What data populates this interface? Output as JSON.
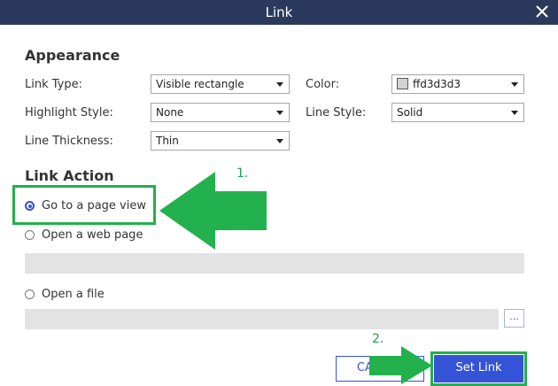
{
  "dialog": {
    "title": "Link",
    "close_icon": "close-icon"
  },
  "appearance": {
    "heading": "Appearance",
    "link_type": {
      "label": "Link Type:",
      "value": "Visible rectangle"
    },
    "color": {
      "label": "Color:",
      "value": "ffd3d3d3",
      "swatch": "#d3d3d3"
    },
    "highlight_style": {
      "label": "Highlight Style:",
      "value": "None"
    },
    "line_style": {
      "label": "Line Style:",
      "value": "Solid"
    },
    "line_thickness": {
      "label": "Line Thickness:",
      "value": "Thin"
    }
  },
  "link_action": {
    "heading": "Link Action",
    "options": [
      {
        "label": "Go to a page view",
        "selected": true
      },
      {
        "label": "Open a web page",
        "selected": false
      },
      {
        "label": "Open a file",
        "selected": false
      }
    ],
    "web_page_value": "",
    "file_value": "",
    "browse_label": "..."
  },
  "buttons": {
    "cancel": "CANCEL",
    "set_link": "Set Link"
  },
  "annotations": {
    "step1": "1.",
    "step2": "2.",
    "arrow_color": "#22b14c"
  },
  "colors": {
    "titlebar": "#2b3a5c",
    "accent": "#3553d6",
    "annotation": "#22b14c"
  }
}
